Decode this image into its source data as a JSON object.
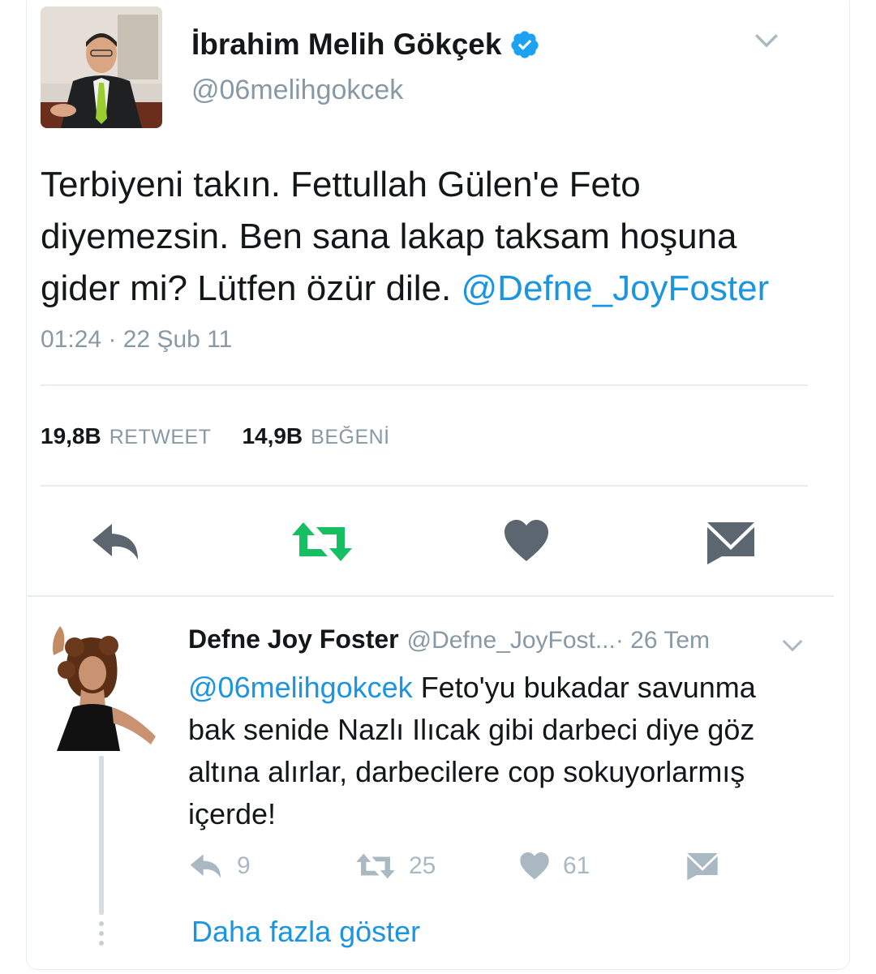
{
  "main_tweet": {
    "author_name": "İbrahim Melih Gökçek",
    "handle": "@06melihgokcek",
    "text": "Terbiyeni takın. Fettullah Gülen'e Feto diyemezsin. Ben sana lakap taksam hoşuna gider mi? Lütfen özür dile.",
    "mention": "@Defne_JoyFoster",
    "timestamp": "01:24 · 22 Şub 11",
    "retweet_count": "19,8B",
    "retweet_label": "RETWEET",
    "like_count": "14,9B",
    "like_label": "BEĞENİ",
    "icons": {
      "verified": "verified-badge-icon",
      "reply": "reply-icon",
      "retweet": "retweet-icon",
      "like": "heart-icon",
      "message": "envelope-icon"
    },
    "colors": {
      "retweet_active": "#17bf63",
      "verified": "#1da1f2",
      "icon": "#5b6670"
    }
  },
  "reply_tweet": {
    "author_name": "Defne Joy Foster",
    "handle": "@Defne_JoyFost...",
    "date": " · 26 Tem",
    "mention": "@06melihgokcek",
    "text": " Feto'yu bukadar savunma bak senide Nazlı Ilıcak gibi darbeci diye göz altına alırlar, darbecilere cop sokuyorlarmış içerde!",
    "reply_count": "9",
    "retweet_count": "25",
    "like_count": "61",
    "icons": {
      "reply": "reply-icon",
      "retweet": "retweet-icon",
      "like": "heart-icon",
      "message": "envelope-icon"
    }
  },
  "show_more_label": "Daha fazla göster",
  "colors": {
    "link": "#1b95e0",
    "muted": "#8899a6",
    "divider": "#e6ecf0"
  }
}
